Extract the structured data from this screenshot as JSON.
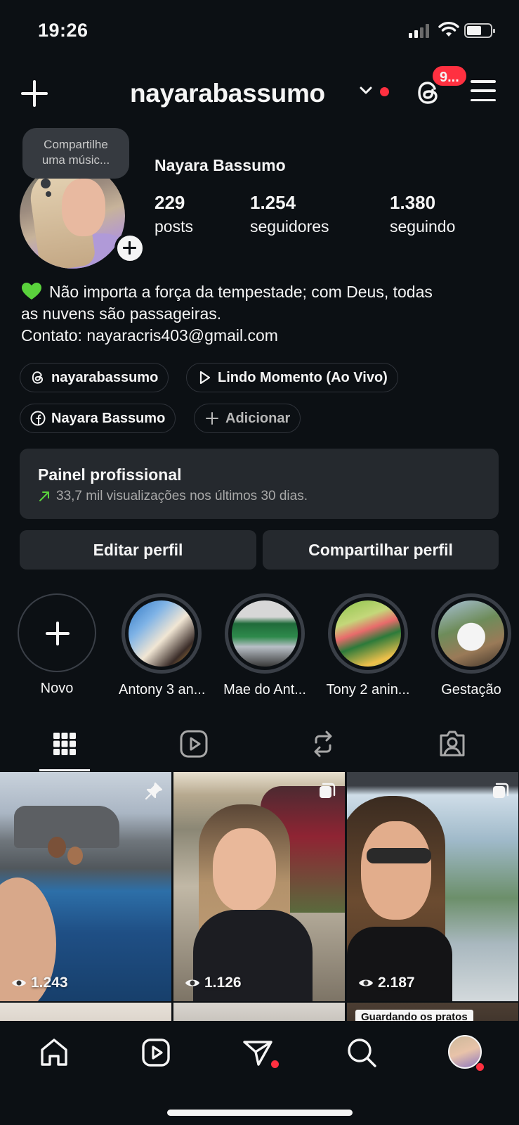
{
  "status_bar": {
    "time": "19:26"
  },
  "header": {
    "username": "nayarabassumo",
    "notification_count": "9..."
  },
  "note": {
    "text_line1": "Compartilhe",
    "text_line2": "uma músic..."
  },
  "profile": {
    "full_name": "Nayara Bassumo",
    "stats": [
      {
        "value": "229",
        "label": "posts"
      },
      {
        "value": "1.254",
        "label": "seguidores"
      },
      {
        "value": "1.380",
        "label": "seguindo"
      }
    ],
    "bio_line1": "Não importa a força da tempestade; com Deus, todas",
    "bio_line2": "as nuvens são passageiras.",
    "bio_line3": "Contato: nayaracris403@gmail.com"
  },
  "links": {
    "threads": "nayarabassumo",
    "music": "Lindo Momento (Ao Vivo)",
    "facebook": "Nayara Bassumo",
    "add": "Adicionar"
  },
  "dashboard": {
    "title": "Painel profissional",
    "subtitle": "33,7 mil visualizações nos últimos 30 dias."
  },
  "actions": {
    "edit": "Editar perfil",
    "share": "Compartilhar perfil"
  },
  "highlights": [
    {
      "label": "Novo"
    },
    {
      "label": "Antony 3 an..."
    },
    {
      "label": "Mae do Ant..."
    },
    {
      "label": "Tony 2 anin..."
    },
    {
      "label": "Gestação"
    }
  ],
  "tabs": [
    "grid-icon",
    "reels-icon",
    "reposts-icon",
    "tagged-icon"
  ],
  "posts": [
    {
      "views": "1.243",
      "badge": "pin-icon"
    },
    {
      "views": "1.126",
      "badge": "carousel-icon"
    },
    {
      "views": "2.187",
      "badge": "carousel-icon"
    }
  ],
  "post_row2": {
    "caption": "Guardando os pratos"
  },
  "colors": {
    "background": "#0c1014",
    "accent_red": "#ff3040",
    "surface": "#25292e",
    "heart": "#5ad23c"
  }
}
